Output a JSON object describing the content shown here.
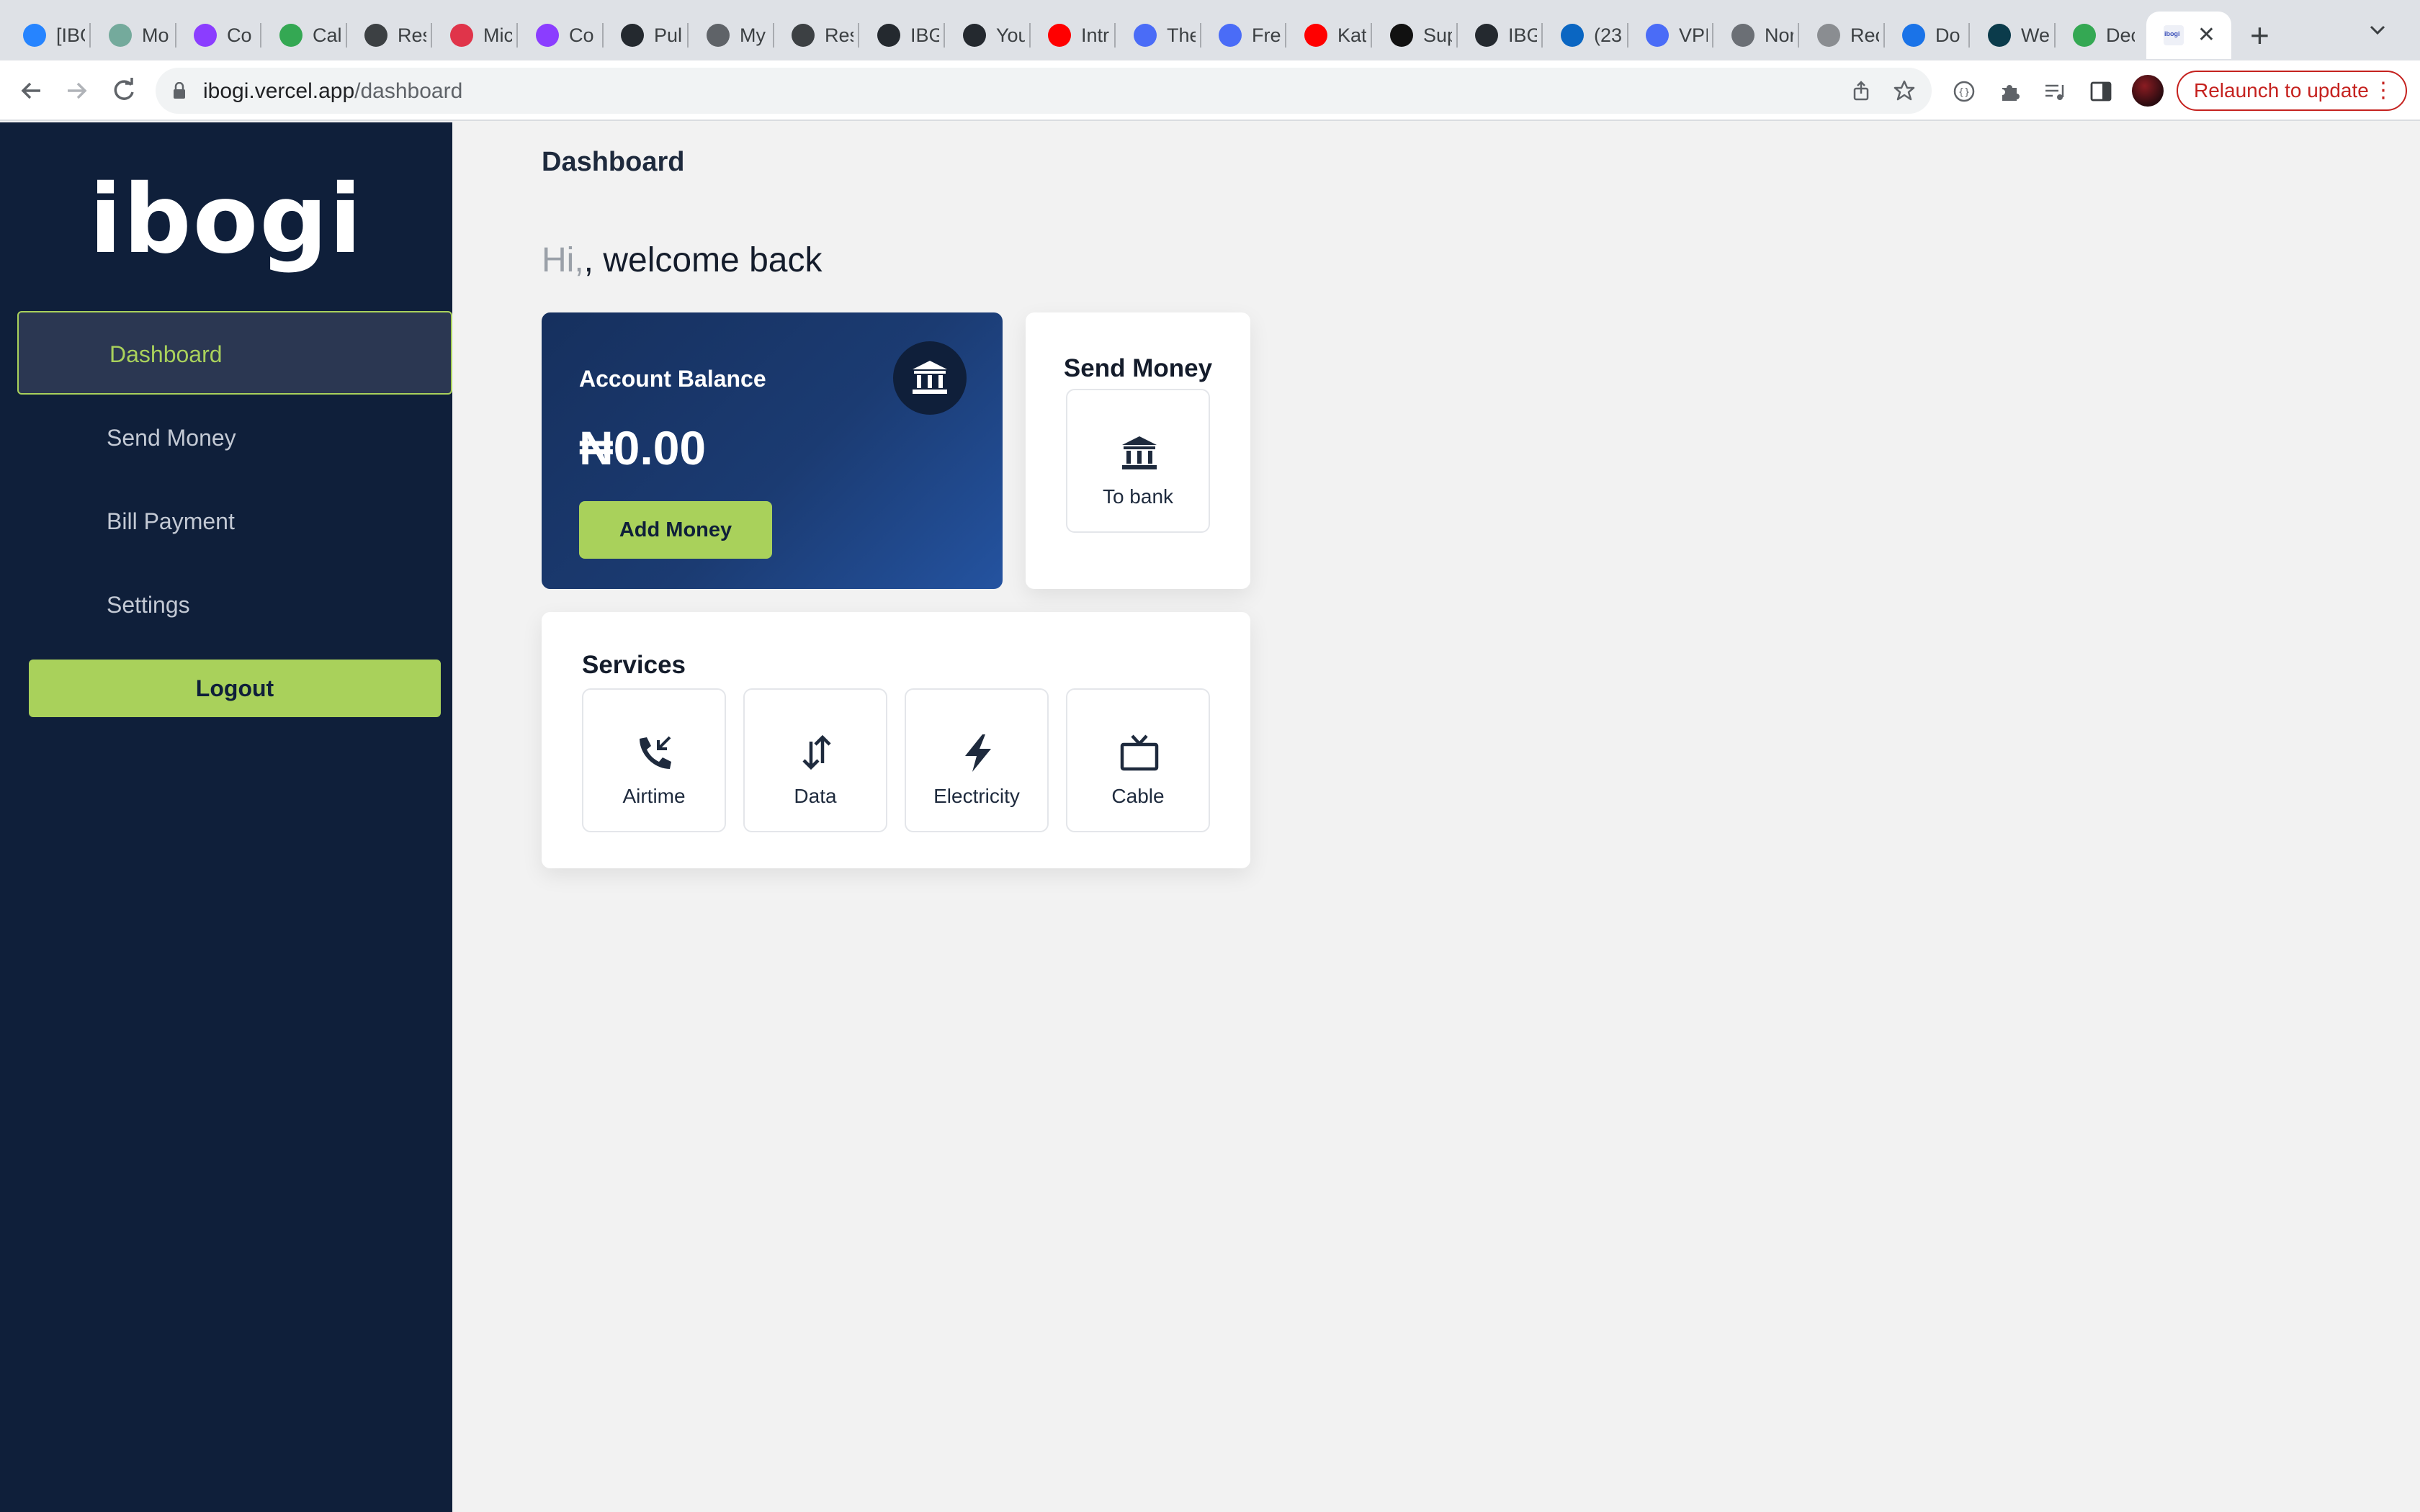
{
  "browser": {
    "tabs": [
      {
        "title": "[IBG",
        "icon": "jira-icon",
        "color": "#2684ff"
      },
      {
        "title": "Mo",
        "icon": "chatgpt-icon",
        "color": "#74aa9c"
      },
      {
        "title": "Co",
        "icon": "course-icon",
        "color": "#8b3dff"
      },
      {
        "title": "Cal",
        "icon": "calculator-icon",
        "color": "#34a853"
      },
      {
        "title": "Res",
        "icon": "resource-icon",
        "color": "#3c4043"
      },
      {
        "title": "Mic",
        "icon": "mic-icon",
        "color": "#e0344a"
      },
      {
        "title": "Co",
        "icon": "course-icon",
        "color": "#8b3dff"
      },
      {
        "title": "Pul",
        "icon": "github-icon",
        "color": "#24292f"
      },
      {
        "title": "My",
        "icon": "globe-icon",
        "color": "#5f6368"
      },
      {
        "title": "Res",
        "icon": "resource-icon",
        "color": "#3c4043"
      },
      {
        "title": "IBG",
        "icon": "github-icon",
        "color": "#24292f"
      },
      {
        "title": "You",
        "icon": "github-icon",
        "color": "#24292f"
      },
      {
        "title": "Intr",
        "icon": "youtube-icon",
        "color": "#ff0000"
      },
      {
        "title": "The",
        "icon": "arc-icon",
        "color": "#4a6cf7"
      },
      {
        "title": "Fre",
        "icon": "arc-icon",
        "color": "#4a6cf7"
      },
      {
        "title": "Kat",
        "icon": "youtube-icon",
        "color": "#ff0000"
      },
      {
        "title": "Sup",
        "icon": "square-icon",
        "color": "#111111"
      },
      {
        "title": "IBG",
        "icon": "github-icon",
        "color": "#24292f"
      },
      {
        "title": "(23",
        "icon": "linkedin-icon",
        "color": "#0a66c2"
      },
      {
        "title": "VPI",
        "icon": "arc-icon",
        "color": "#4a6cf7"
      },
      {
        "title": "Nor",
        "icon": "arc-icon",
        "color": "#6b6f75"
      },
      {
        "title": "Rec",
        "icon": "globe-icon",
        "color": "#8a8d91"
      },
      {
        "title": "Do",
        "icon": "download-icon",
        "color": "#1a73e8"
      },
      {
        "title": "We",
        "icon": "react-icon",
        "color": "#0b3b4b"
      },
      {
        "title": "Dec",
        "icon": "docs-icon",
        "color": "#34a853"
      }
    ],
    "active_tab": {
      "title": "ibogi"
    },
    "url_host": "ibogi.vercel.app",
    "url_path": "/dashboard",
    "relaunch_label": "Relaunch to update"
  },
  "sidebar": {
    "logo": "ibogi",
    "items": [
      {
        "label": "Dashboard",
        "active": true
      },
      {
        "label": "Send Money",
        "active": false
      },
      {
        "label": "Bill Payment",
        "active": false
      },
      {
        "label": "Settings",
        "active": false
      }
    ],
    "logout_label": "Logout"
  },
  "main": {
    "page_title": "Dashboard",
    "greeting_hi": "Hi,",
    "greeting_rest": ", welcome back",
    "balance": {
      "label": "Account Balance",
      "amount": "₦0.00",
      "add_money_label": "Add Money"
    },
    "send_money": {
      "title": "Send Money",
      "to_bank_label": "To bank"
    },
    "services": {
      "title": "Services",
      "items": [
        {
          "label": "Airtime",
          "icon": "phone-incoming-icon"
        },
        {
          "label": "Data",
          "icon": "arrows-up-down-icon"
        },
        {
          "label": "Electricity",
          "icon": "lightning-icon"
        },
        {
          "label": "Cable",
          "icon": "tv-icon"
        }
      ]
    }
  },
  "colors": {
    "sidebar_bg": "#0f1f3a",
    "accent_green": "#a9d15b",
    "card_blue": "#1b3b72",
    "page_bg": "#f2f2f2"
  }
}
